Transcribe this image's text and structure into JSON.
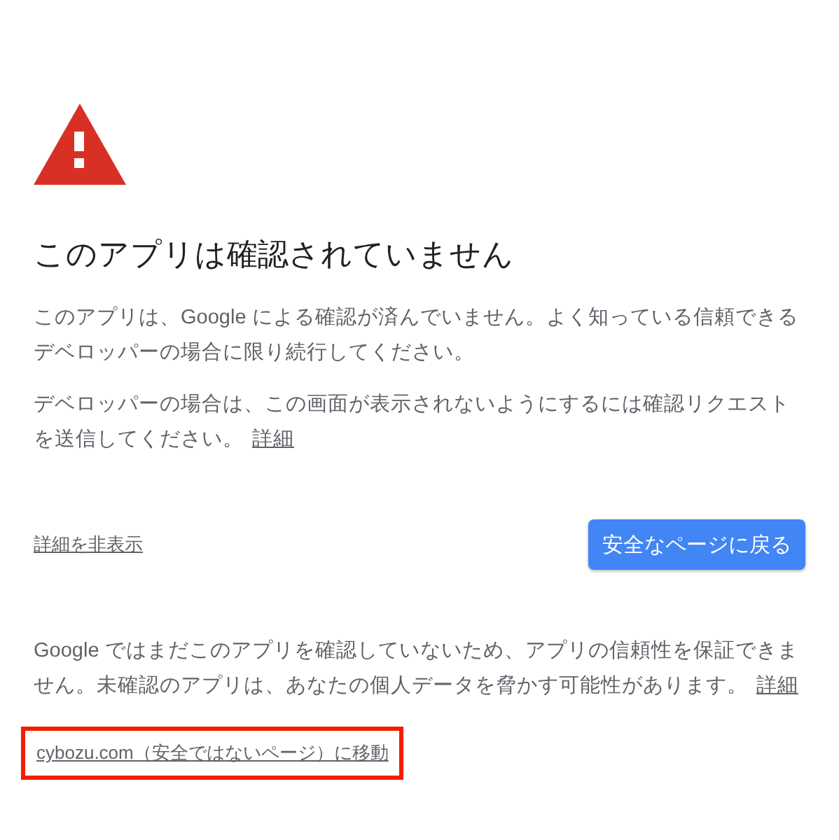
{
  "title": "このアプリは確認されていません",
  "paragraphs": [
    {
      "text": "このアプリは、Google による確認が済んでいません。よく知っている信頼できるデベロッパーの場合に限り続行してください。"
    },
    {
      "text": "デベロッパーの場合は、この画面が表示されないようにするには確認リクエストを送信してください。",
      "link": "詳細"
    }
  ],
  "hide_details_link": "詳細を非表示",
  "back_button": "安全なページに戻る",
  "warning": {
    "text": "Google ではまだこのアプリを確認していないため、アプリの信頼性を保証できません。未確認のアプリは、あなたの個人データを脅かす可能性があります。",
    "link": "詳細"
  },
  "proceed_link": {
    "label": "cybozu.com（安全ではないページ）に移動",
    "highlighted": true
  }
}
